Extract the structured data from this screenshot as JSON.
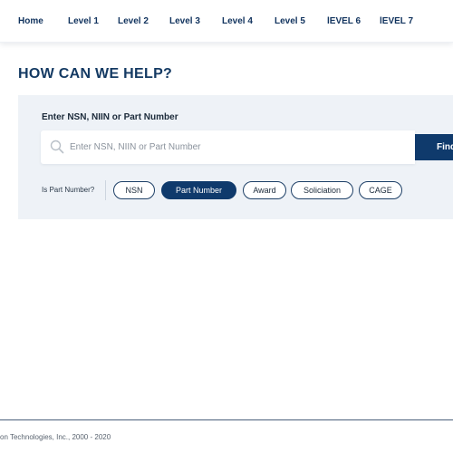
{
  "nav": {
    "items": [
      {
        "label": "Home"
      },
      {
        "label": "Level 1"
      },
      {
        "label": "Level 2"
      },
      {
        "label": "Level 3"
      },
      {
        "label": "Level 4"
      },
      {
        "label": "Level 5"
      },
      {
        "label": "lEVEL 6"
      },
      {
        "label": "lEVEL 7"
      }
    ]
  },
  "main": {
    "title": "HOW CAN WE HELP?"
  },
  "search": {
    "label": "Enter NSN, NIIN or Part Number",
    "placeholder": "Enter NSN, NIIN or Part Number",
    "value": "",
    "button_label": "Find",
    "search_icon": "search-icon"
  },
  "filters": {
    "label": "Is Part Number?",
    "selected": "Part Number",
    "options": [
      {
        "label": "NSN"
      },
      {
        "label": "Part Number"
      },
      {
        "label": "Award"
      },
      {
        "label": "Soliciation"
      },
      {
        "label": "CAGE"
      }
    ]
  },
  "footer": {
    "text": "on Technologies, Inc., 2000 - 2020"
  },
  "colors": {
    "brand_navy": "#0f3a6c",
    "heading_navy": "#143a63",
    "panel_bg": "#eef2f7"
  }
}
